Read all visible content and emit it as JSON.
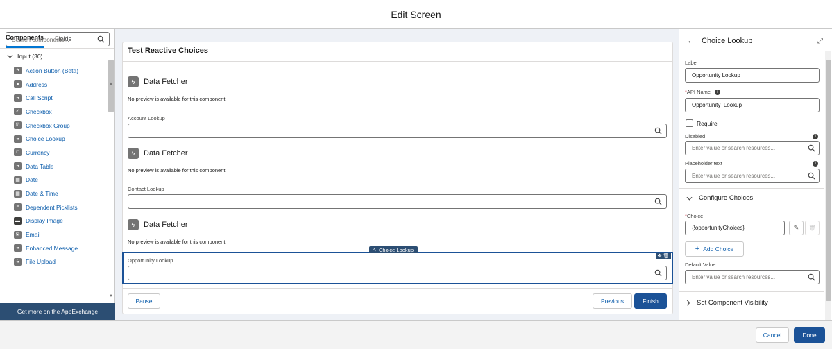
{
  "header": {
    "title": "Edit Screen"
  },
  "left_panel": {
    "tabs": [
      "Components",
      "Fields"
    ],
    "search_placeholder": "Search components...",
    "group_label": "Input (30)",
    "items": [
      {
        "label": "Action Button (Beta)",
        "icon": "lightning-icon"
      },
      {
        "label": "Address",
        "icon": "address-icon"
      },
      {
        "label": "Call Script",
        "icon": "lightning-icon"
      },
      {
        "label": "Checkbox",
        "icon": "checkbox-icon"
      },
      {
        "label": "Checkbox Group",
        "icon": "checkbox-group-icon"
      },
      {
        "label": "Choice Lookup",
        "icon": "lightning-icon"
      },
      {
        "label": "Currency",
        "icon": "currency-icon"
      },
      {
        "label": "Data Table",
        "icon": "lightning-icon"
      },
      {
        "label": "Date",
        "icon": "calendar-icon"
      },
      {
        "label": "Date & Time",
        "icon": "calendar-time-icon"
      },
      {
        "label": "Dependent Picklists",
        "icon": "picklist-icon"
      },
      {
        "label": "Display Image",
        "icon": "image-icon"
      },
      {
        "label": "Email",
        "icon": "email-icon"
      },
      {
        "label": "Enhanced Message",
        "icon": "lightning-icon"
      },
      {
        "label": "File Upload",
        "icon": "lightning-icon"
      }
    ],
    "appexchange_label": "Get more on the AppExchange"
  },
  "canvas": {
    "card_title": "Test Reactive Choices",
    "fetchers": [
      {
        "title": "Data Fetcher",
        "note": "No preview is available for this component.",
        "lookup_label": "Account Lookup"
      },
      {
        "title": "Data Fetcher",
        "note": "No preview is available for this component.",
        "lookup_label": "Contact Lookup"
      },
      {
        "title": "Data Fetcher",
        "note": "No preview is available for this component.",
        "lookup_label": "Opportunity Lookup"
      }
    ],
    "selected_tag": "Choice Lookup",
    "buttons": {
      "pause": "Pause",
      "previous": "Previous",
      "finish": "Finish"
    }
  },
  "right_panel": {
    "title": "Choice Lookup",
    "label_label": "Label",
    "label_value": "Opportunity Lookup",
    "api_name_label": "API Name",
    "api_name_required": "*",
    "api_name_value": "Opportunity_Lookup",
    "require_label": "Require",
    "disabled_label": "Disabled",
    "disabled_placeholder": "Enter value or search resources...",
    "placeholder_label": "Placeholder text",
    "placeholder_placeholder": "Enter value or search resources...",
    "configure_choices": "Configure Choices",
    "choice_label": "Choice",
    "choice_required": "*",
    "choice_value": "{!opportunityChoices}",
    "add_choice": "Add Choice",
    "default_value_label": "Default Value",
    "default_value_placeholder": "Enter value or search resources...",
    "set_visibility": "Set Component Visibility"
  },
  "footer": {
    "cancel": "Cancel",
    "done": "Done"
  },
  "colors": {
    "brand": "#1b5297",
    "link": "#0b5cab",
    "appexchange": "#2c4e73",
    "canvas_bg": "#eef1f6"
  }
}
